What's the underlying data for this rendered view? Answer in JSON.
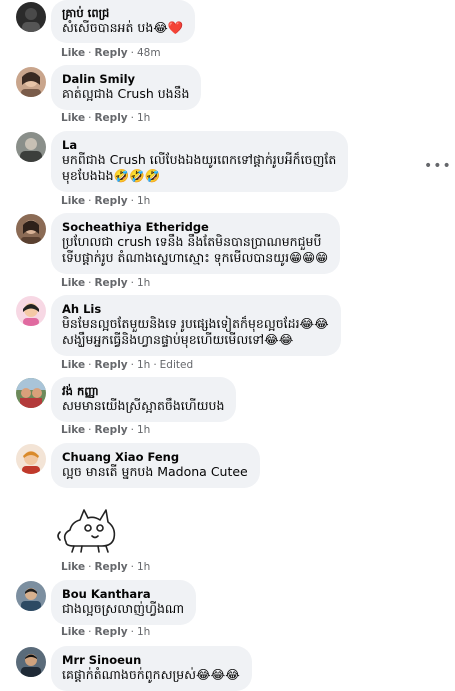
{
  "comments": [
    {
      "author": "គ្រាប់ ពេជ្រ",
      "text": "សំសើចបានអត់ បង😂❤️",
      "like": "Like",
      "reply": "Reply",
      "time": "48m"
    },
    {
      "author": "Dalin Smily",
      "text": "គាត់ល្អជាង Crush បងនឹង",
      "like": "Like",
      "reply": "Reply",
      "time": "1h"
    },
    {
      "author": "La",
      "text_line1": "មកពីជាង Crush លើបែងឯងយូរពេកទៅផ្ដាក់រូបអីក៏ចេញតែ",
      "text_line2": "មុខបែងឯង🤣🤣🤣",
      "like": "Like",
      "reply": "Reply",
      "time": "1h",
      "more_icon": "more-horizontal-icon"
    },
    {
      "author": "Socheathiya Etheridge",
      "text_line1": "ប្រហែលជា crush ទេនឹង នឹងតែមិនបានប្រាណមកជួមបី",
      "text_line2": "ទើបផ្ដាក់រូប តំណាងស្នេហាស្មោះ ទុកមើលបានយូរ😁😁😁",
      "like": "Like",
      "reply": "Reply",
      "time": "1h"
    },
    {
      "author": "Ah Lis",
      "text_line1": "មិនមែនល្អចតែមួយនិងទេ រូបផ្សេងទៀតក៏មុខល្អចដែរ😂😂",
      "text_line2": "សង្ឃឹមអ្នកធ្វើនិងហ្វានផ្ទាប់មុខហើយមើលទៅ😂😂",
      "like": "Like",
      "reply": "Reply",
      "time": "1h",
      "edited": "Edited"
    },
    {
      "author": "វង់ កញ្ញា",
      "text": "សមមានយើងស្រីស្អាតចឹងហើយបង",
      "like": "Like",
      "reply": "Reply",
      "time": "1h"
    },
    {
      "author": "Chuang Xiao Feng",
      "text": "ល្អច មានតើ ម្នកបង Madona Cutee",
      "like": "Like",
      "reply": "Reply",
      "time": "1h"
    },
    {
      "sticker_icon": "cat-sticker-icon",
      "like": "Like",
      "reply": "Reply",
      "time": "1h"
    },
    {
      "author": "Bou Kanthara",
      "text": "ជាងល្អចស្រលាញ់ហ្វីងណា",
      "like": "Like",
      "reply": "Reply",
      "time": "1h"
    },
    {
      "author": "Mrr Sinoeun",
      "text": "គេផ្ដាក់តំណាងចក់ពូកសម្រស់😂😂😂",
      "like": "Like",
      "reply": "Reply",
      "time": "1h"
    }
  ],
  "separator": "·",
  "colors": {
    "bubble_bg": "#f0f2f5",
    "meta_text": "#65676b",
    "name_text": "#050505"
  }
}
